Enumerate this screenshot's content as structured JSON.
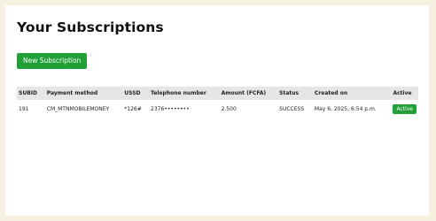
{
  "page": {
    "title": "Your Subscriptions",
    "new_subscription_label": "New Subscription"
  },
  "table": {
    "columns": [
      "SUBID",
      "Payment method",
      "USSD",
      "Telephone number",
      "Amount (FCFA)",
      "Status",
      "Created on",
      "Active"
    ],
    "rows": [
      {
        "subid": "191",
        "payment_method": "CM_MTNMOBILEMONEY",
        "ussd": "*126#",
        "telephone": "2376••••••••",
        "amount": "2.500",
        "status": "SUCCESS",
        "created_on": "May 6, 2025, 6:54 p.m.",
        "active": "Active"
      }
    ]
  },
  "colors": {
    "page_background": "#f6f0e1",
    "panel_background": "#ffffff",
    "accent_green": "#21a038",
    "header_gray": "#e6e6e6"
  }
}
